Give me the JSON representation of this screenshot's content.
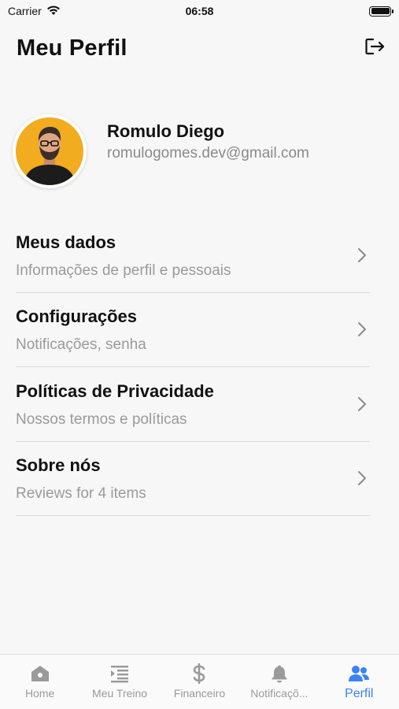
{
  "status_bar": {
    "carrier": "Carrier",
    "time": "06:58"
  },
  "header": {
    "title": "Meu Perfil",
    "logout_icon": "logout-icon"
  },
  "profile": {
    "name": "Romulo Diego",
    "email": "romulogomes.dev@gmail.com"
  },
  "menu": {
    "items": [
      {
        "title": "Meus dados",
        "subtitle": "Informações de perfil e pessoais"
      },
      {
        "title": "Configurações",
        "subtitle": "Notificações, senha"
      },
      {
        "title": "Políticas de Privacidade",
        "subtitle": "Nossos termos e políticas"
      },
      {
        "title": "Sobre nós",
        "subtitle": "Reviews for 4 items"
      }
    ]
  },
  "tabbar": {
    "tabs": [
      {
        "label": "Home",
        "icon": "home-icon"
      },
      {
        "label": "Meu Treino",
        "icon": "list-indent-icon"
      },
      {
        "label": "Financeiro",
        "icon": "dollar-icon"
      },
      {
        "label": "Notificaçõ...",
        "icon": "bell-icon"
      },
      {
        "label": "Perfil",
        "icon": "users-icon"
      }
    ],
    "active_color": "#3a82f7",
    "inactive_color": "#9a9a9a"
  }
}
